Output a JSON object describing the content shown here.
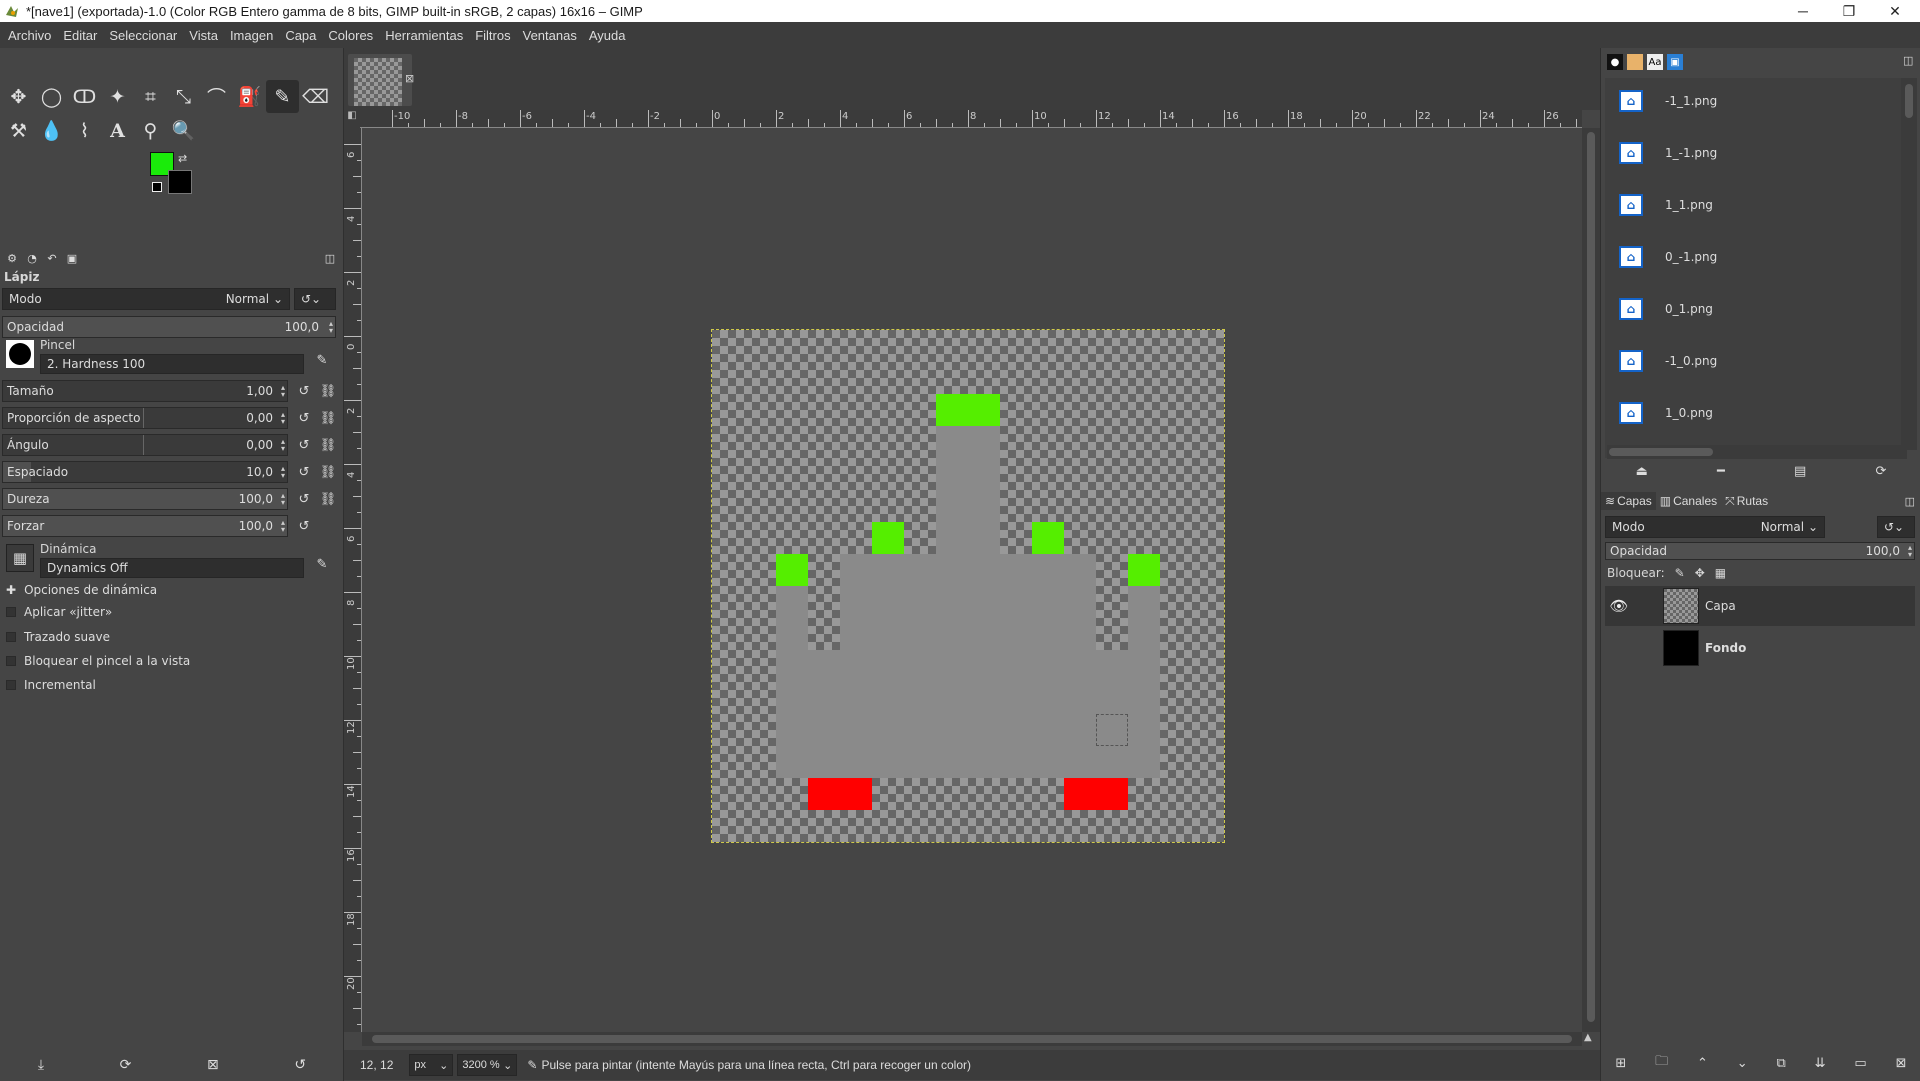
{
  "window": {
    "title": "*[nave1] (exportada)-1.0 (Color RGB Entero gamma de 8 bits, GIMP built-in sRGB, 2 capas) 16x16 – GIMP",
    "controls": [
      "minimize-icon",
      "maximize-icon",
      "close-icon"
    ]
  },
  "menu": [
    "Archivo",
    "Editar",
    "Seleccionar",
    "Vista",
    "Imagen",
    "Capa",
    "Colores",
    "Herramientas",
    "Filtros",
    "Ventanas",
    "Ayuda"
  ],
  "colors": {
    "foreground": "#1aeb0a",
    "background": "#000000",
    "pixel_green": "#55ee00",
    "pixel_gray": "#8a8a8a",
    "pixel_blue": "#0a0af0",
    "pixel_white": "#ffffff",
    "pixel_red": "#ff0000"
  },
  "tool_options": {
    "title": "Lápiz",
    "mode_label": "Modo",
    "mode_value": "Normal",
    "opacity_label": "Opacidad",
    "opacity_value": "100,0",
    "brush_label": "Pincel",
    "brush_value": "2. Hardness 100",
    "size_label": "Tamaño",
    "size_value": "1,00",
    "aspect_label": "Proporción de aspecto",
    "aspect_value": "0,00",
    "angle_label": "Ángulo",
    "angle_value": "0,00",
    "spacing_label": "Espaciado",
    "spacing_value": "10,0",
    "hardness_label": "Dureza",
    "hardness_value": "100,0",
    "force_label": "Forzar",
    "force_value": "100,0",
    "dynamics_label": "Dinámica",
    "dynamics_value": "Dynamics Off",
    "dyn_options": "Opciones de dinámica",
    "jitter": "Aplicar «jitter»",
    "smooth": "Trazado suave",
    "lock_brush": "Bloquear el pincel a la vista",
    "incremental": "Incremental"
  },
  "ruler": {
    "h_labels": [
      "-10",
      "-8",
      "-6",
      "-4",
      "-2",
      "0",
      "2",
      "4",
      "6",
      "8",
      "10",
      "12",
      "14",
      "16",
      "18",
      "20",
      "22",
      "24",
      "26"
    ],
    "v_labels": [
      "6",
      "4",
      "2",
      "0",
      "2",
      "4",
      "6",
      "8",
      "10",
      "12",
      "14",
      "16",
      "18",
      "20"
    ]
  },
  "status": {
    "coords": "12, 12",
    "unit": "px",
    "zoom": "3200 %",
    "message": "Pulse para pintar (intente Mayús para una línea recta, Ctrl para recoger un color)"
  },
  "images_panel": {
    "items": [
      "-1_1.png",
      "1_-1.png",
      "1_1.png",
      "0_-1.png",
      "0_1.png",
      "-1_0.png",
      "1_0.png"
    ]
  },
  "layers_panel": {
    "tabs": [
      "Capas",
      "Canales",
      "Rutas"
    ],
    "mode_label": "Modo",
    "mode_value": "Normal",
    "opacity_label": "Opacidad",
    "opacity_value": "100,0",
    "lock_label": "Bloquear:",
    "layers": [
      {
        "name": "Capa",
        "visible": true
      },
      {
        "name": "Fondo",
        "visible": false
      }
    ]
  }
}
